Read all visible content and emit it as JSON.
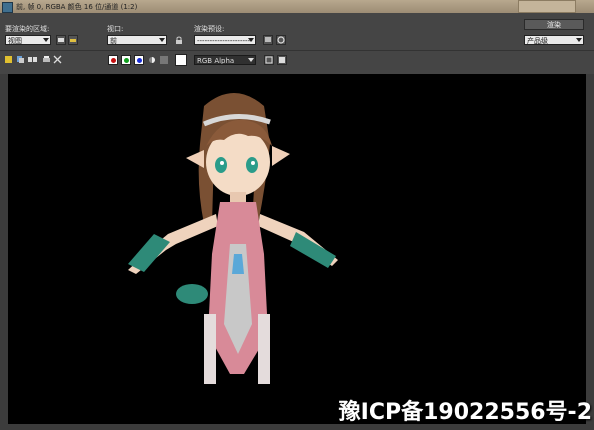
{
  "window": {
    "title": "前, 帧 0, RGBA 颜色 16 位/通道 (1:2)"
  },
  "toolbar": {
    "area_label": "要渲染的区域:",
    "area_value": "视图",
    "viewport_label": "视口:",
    "viewport_value": "前",
    "preset_label": "渲染预设:",
    "preset_value": "------------------------",
    "render_button": "渲染",
    "product_value": "产品级",
    "channel_value": "RGB Alpha"
  },
  "colors": {
    "red_channel": "#c41010",
    "green_channel": "#12a020",
    "blue_channel": "#1a2ed8",
    "viewport_bg": "#000000"
  },
  "icons": {
    "row2": [
      "save-image-icon",
      "copy-image-icon",
      "clone-window-icon",
      "print-icon",
      "clear-icon"
    ]
  },
  "watermark": "豫ICP备19022556号-2"
}
